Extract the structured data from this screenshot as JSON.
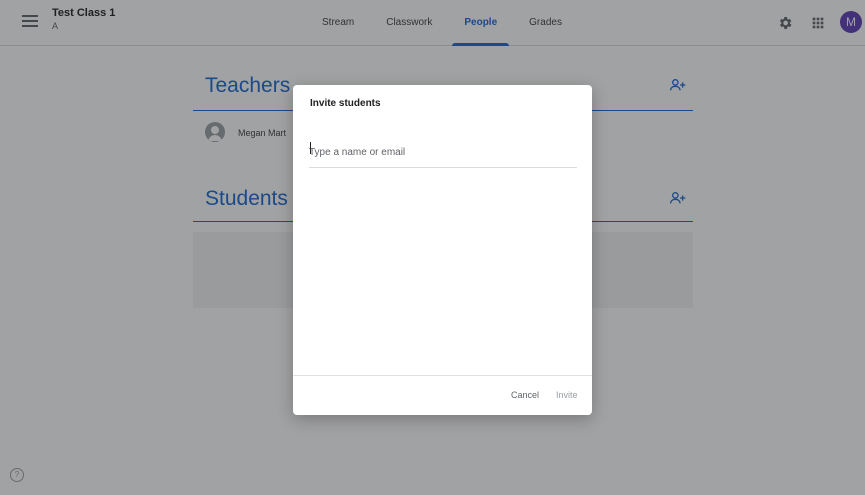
{
  "header": {
    "class_title": "Test Class 1",
    "class_section": "A",
    "tabs": [
      {
        "label": "Stream",
        "active": false
      },
      {
        "label": "Classwork",
        "active": false
      },
      {
        "label": "People",
        "active": true
      },
      {
        "label": "Grades",
        "active": false
      }
    ],
    "avatar_initial": "M",
    "icons": [
      "menu-icon",
      "gear-icon",
      "apps-grid-icon"
    ]
  },
  "people": {
    "teachers_title": "Teachers",
    "teacher_name": "Megan Mart",
    "students_title": "Students"
  },
  "dialog": {
    "title": "Invite students",
    "input_placeholder": "Type a name or email",
    "cancel_label": "Cancel",
    "invite_label": "Invite"
  },
  "footer": {
    "help_label": "?"
  },
  "colors": {
    "accent": "#1967d2",
    "avatar": "#5c3bb5",
    "scrim": "rgba(32,33,36,0.42)"
  }
}
